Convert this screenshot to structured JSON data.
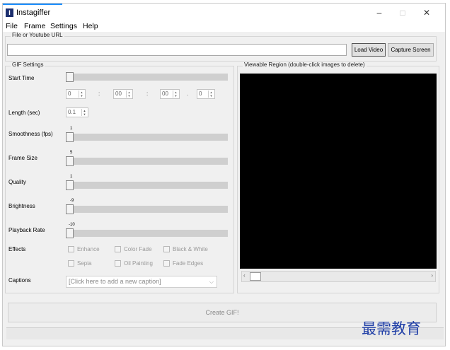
{
  "window": {
    "title": "Instagiffer",
    "icon_letter": "I",
    "minimize": "–",
    "maximize": "□",
    "close": "✕"
  },
  "menu": [
    "File",
    "Frame",
    "Settings",
    "Help"
  ],
  "source": {
    "group_title": "File or Youtube URL",
    "url_value": "",
    "load_button": "Load Video",
    "capture_button": "Capture Screen"
  },
  "gif_settings": {
    "group_title": "GIF Settings",
    "start_time": {
      "label": "Start Time",
      "fields": [
        "0",
        "00",
        "00",
        "0"
      ],
      "separators": [
        ":",
        ":",
        "."
      ]
    },
    "length": {
      "label": "Length (sec)",
      "value": "0.1"
    },
    "sliders": [
      {
        "label": "Smoothness (fps)",
        "value": "1",
        "level": 0
      },
      {
        "label": "Frame Size",
        "value": "5",
        "level": 0
      },
      {
        "label": "Quality",
        "value": "1",
        "level": 0
      },
      {
        "label": "Brightness",
        "value": "-9",
        "level": 0
      },
      {
        "label": "Playback Rate",
        "value": "-10",
        "level": 0
      }
    ],
    "effects_label": "Effects",
    "effects": [
      "Enhance",
      "Color Fade",
      "Black & White",
      "Sepia",
      "Oil Painting",
      "Fade Edges"
    ],
    "captions_label": "Captions",
    "caption_placeholder": "[Click here to add a new caption]"
  },
  "viewer": {
    "group_title": "Viewable Region (double-click images to delete)"
  },
  "create_button": "Create GIF!",
  "watermark": "最需教育"
}
